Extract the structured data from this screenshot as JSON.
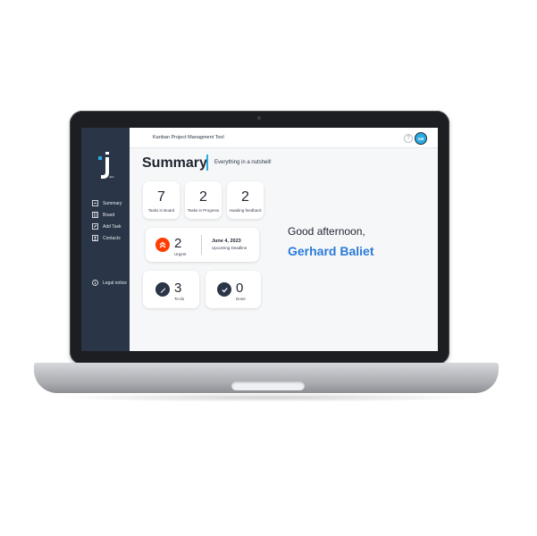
{
  "app": {
    "title": "Kanban Project Managment Tool",
    "logo_text": "Join",
    "avatar_initials": "GB"
  },
  "sidebar": {
    "items": [
      {
        "label": "Summary",
        "icon": "summary-icon"
      },
      {
        "label": "Board",
        "icon": "board-icon"
      },
      {
        "label": "Add Task",
        "icon": "add-task-icon"
      },
      {
        "label": "Contacts",
        "icon": "contacts-icon"
      }
    ],
    "legal": {
      "label": "Legal notice",
      "icon": "info-icon"
    }
  },
  "summary": {
    "title": "Summary",
    "subtitle": "Everything in a nutshell!",
    "cards": {
      "board": {
        "value": "7",
        "label": "Tasks in Board"
      },
      "progress": {
        "value": "2",
        "label": "Tasks in Progress"
      },
      "feedback": {
        "value": "2",
        "label": "Awaiting feedback"
      },
      "urgent": {
        "value": "2",
        "label": "Urgent"
      },
      "deadline": {
        "date": "June 4, 2023",
        "label": "Upcoming Deadline"
      },
      "todo": {
        "value": "3",
        "label": "To-do"
      },
      "done": {
        "value": "0",
        "label": "Done"
      }
    },
    "greeting": "Good afternoon,",
    "user_name": "Gerhard Baliet"
  },
  "colors": {
    "sidebar_bg": "#2a3647",
    "accent": "#29abe2",
    "urgent": "#ff3d00",
    "name_blue": "#2b7bd9"
  }
}
